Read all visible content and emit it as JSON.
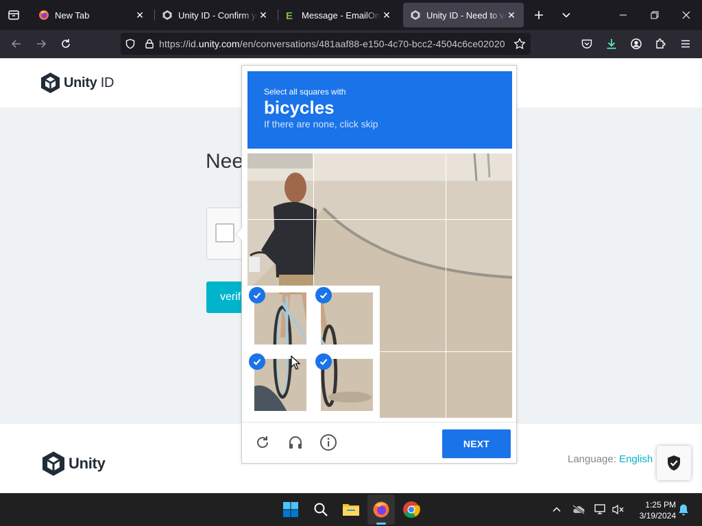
{
  "browser": {
    "tabs": [
      {
        "title": "New Tab",
        "icon": "firefox-icon",
        "active": false
      },
      {
        "title": "Unity ID - Confirm your",
        "icon": "unity-icon",
        "active": false
      },
      {
        "title": "Message - EmailOnDeck",
        "icon": "emailondeck-icon",
        "active": false
      },
      {
        "title": "Unity ID - Need to verify",
        "icon": "unity-icon",
        "active": true
      }
    ],
    "url_prefix": "https://id.",
    "url_domain": "unity.com",
    "url_path": "/en/conversations/481aaf88-e150-4c70-bcc2-4504c6ce02020"
  },
  "page": {
    "logo_bold": "Unity",
    "logo_light": " ID",
    "heading": "Nee",
    "verify_label": "verif",
    "footer_logo": "Unity",
    "language_label": "Language:",
    "language_value": "English"
  },
  "challenge": {
    "instruction": "Select all squares with",
    "target": "bicycles",
    "hint": "If there are none, click skip",
    "grid_rows": 4,
    "grid_cols": 4,
    "selected_tiles": [
      8,
      9,
      12,
      13
    ],
    "next_label": "NEXT",
    "accent_color": "#1a73e8"
  },
  "taskbar": {
    "time": "1:25 PM",
    "date": "3/19/2024"
  }
}
